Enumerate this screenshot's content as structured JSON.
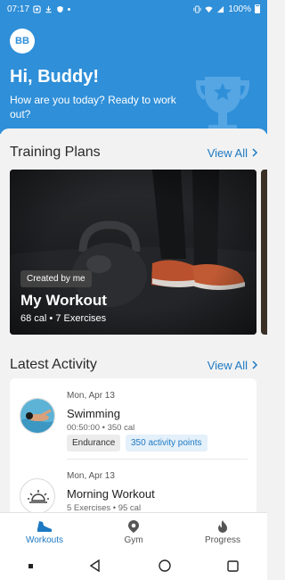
{
  "status_bar": {
    "time": "07:17",
    "battery": "100%"
  },
  "header": {
    "avatar_initials": "BB",
    "greeting": "Hi, Buddy!",
    "subtitle": "How are you today? Ready to work out?"
  },
  "training_plans": {
    "title": "Training Plans",
    "view_all": "View All",
    "cards": [
      {
        "badge": "Created by me",
        "name": "My Workout",
        "meta": "68 cal • 7 Exercises"
      }
    ]
  },
  "latest_activity": {
    "title": "Latest Activity",
    "view_all": "View All",
    "items": [
      {
        "date": "Mon, Apr 13",
        "title": "Swimming",
        "meta": "00:50:00 • 350 cal",
        "tags": [
          "Endurance",
          "350 activity points"
        ],
        "icon": "swimmer-photo"
      },
      {
        "date": "Mon, Apr 13",
        "title": "Morning Workout",
        "meta": "5 Exercises • 95 cal",
        "tags": [],
        "icon": "sunrise-icon"
      }
    ]
  },
  "bottom_nav": {
    "items": [
      {
        "label": "Workouts",
        "icon": "shoe-icon",
        "active": true
      },
      {
        "label": "Gym",
        "icon": "location-pin-icon",
        "active": false
      },
      {
        "label": "Progress",
        "icon": "flame-icon",
        "active": false
      }
    ]
  },
  "colors": {
    "primary": "#2f8fd8",
    "link": "#1d79c2",
    "background": "#f2f2f2"
  }
}
